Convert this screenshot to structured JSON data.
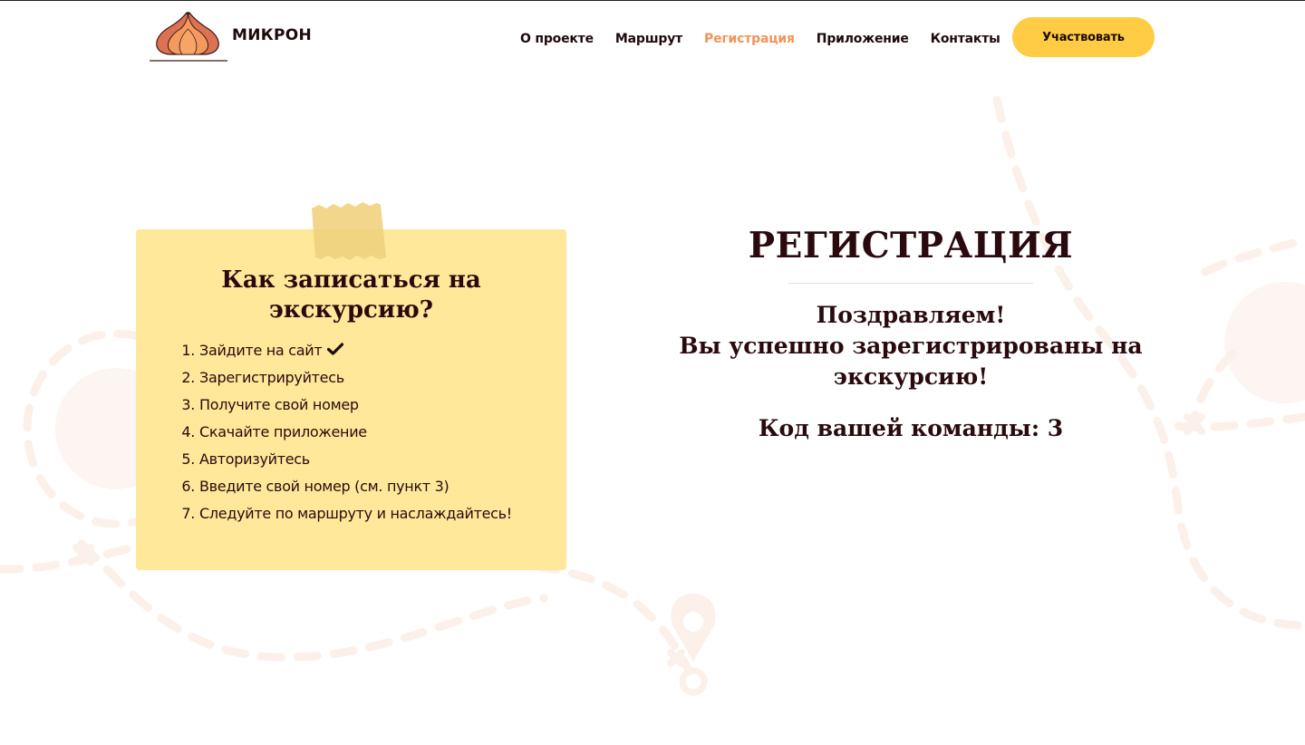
{
  "brand": {
    "name": "МИКРОН",
    "logo_icon": "onion-dome-icon"
  },
  "nav": {
    "items": [
      {
        "label": "О проекте",
        "active": false
      },
      {
        "label": "Маршрут",
        "active": false
      },
      {
        "label": "Регистрация",
        "active": true
      },
      {
        "label": "Приложение",
        "active": false
      },
      {
        "label": "Контакты",
        "active": false
      }
    ],
    "cta_label": "Участвовать"
  },
  "instructions": {
    "title_line1": "Как записаться на",
    "title_line2": "экскурсию?",
    "steps": [
      {
        "num": "1.",
        "text": "Зайдите на сайт",
        "done": true
      },
      {
        "num": "2.",
        "text": "Зарегистрируйтесь",
        "done": false
      },
      {
        "num": "3.",
        "text": "Получите свой номер",
        "done": false
      },
      {
        "num": "4.",
        "text": "Скачайте приложение",
        "done": false
      },
      {
        "num": "5.",
        "text": "Авторизуйтесь",
        "done": false
      },
      {
        "num": "6.",
        "text": "Введите свой номер (см. пункт 3)",
        "done": false
      },
      {
        "num": "7.",
        "text": "Следуйте по маршруту и наслаждайтесь!",
        "done": false
      }
    ]
  },
  "registration": {
    "title": "РЕГИСТРАЦИЯ",
    "congrats_line1": "Поздравляем!",
    "congrats_line2": "Вы успешно зарегистрированы на",
    "congrats_line3": "экскурсию!",
    "team_code_label": "Код вашей команды: 3"
  },
  "colors": {
    "accent": "#f0945a",
    "button": "#ffcc44",
    "card": "#ffe89a",
    "text": "#2a0a0e",
    "decor": "#fbf3ee"
  }
}
